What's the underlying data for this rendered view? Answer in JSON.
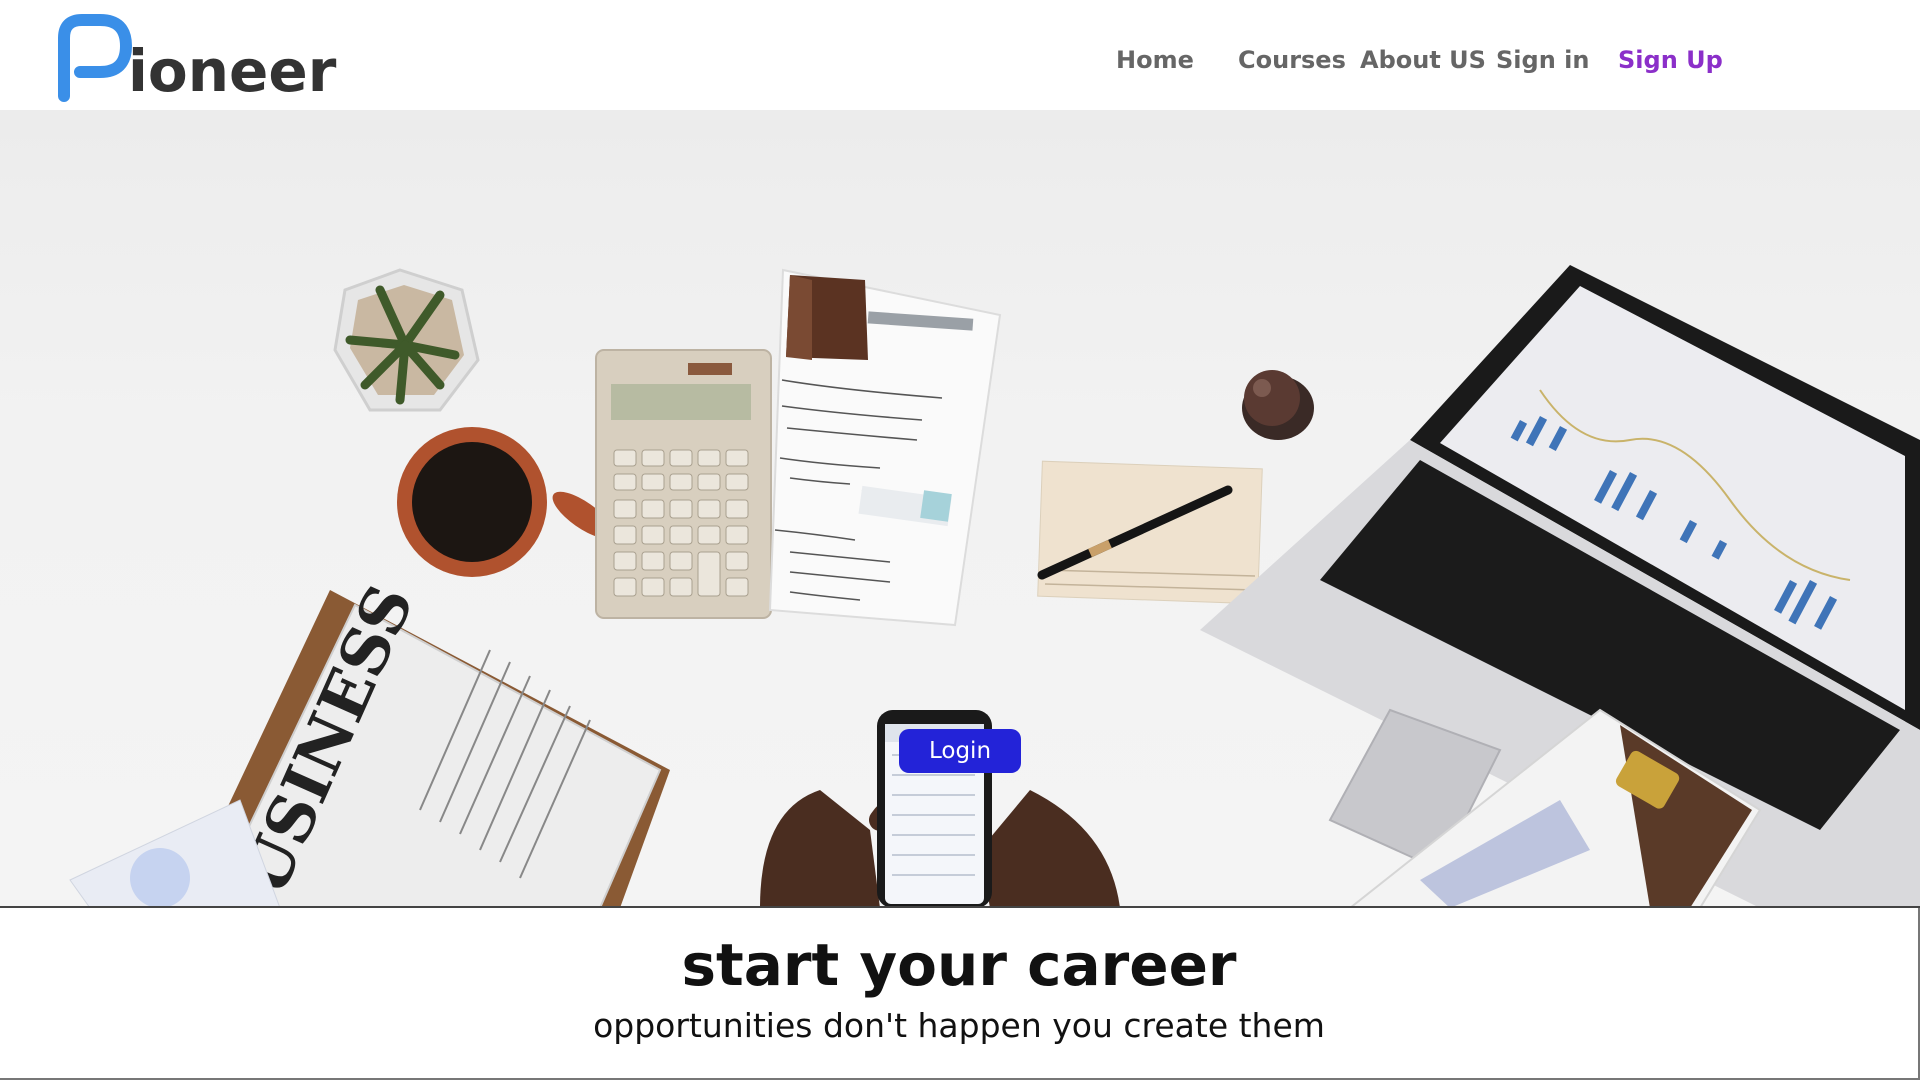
{
  "brand": {
    "name": "ioneer",
    "mark_letter": "P",
    "mark_color": "#3a8fe8"
  },
  "nav": {
    "home": "Home",
    "courses": "Courses",
    "about": "About US",
    "signin": "Sign in",
    "signup": "Sign Up",
    "link_color": "#666666",
    "signup_color": "#8b2fc9"
  },
  "hero": {
    "login_label": "Login",
    "login_color": "#2323d8",
    "image_icon": "desk-workspace-photo"
  },
  "tagline": {
    "title": "start your career",
    "subtitle": "opportunities don't happen you create them"
  }
}
